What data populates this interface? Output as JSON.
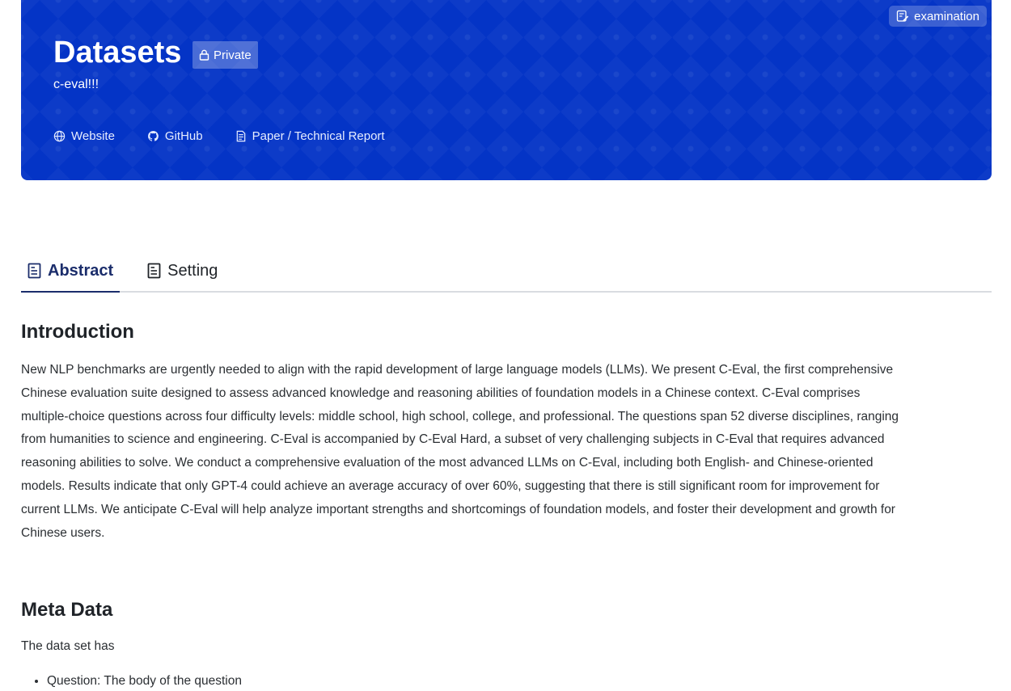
{
  "header": {
    "title": "Datasets",
    "visibility": "Private",
    "subtitle": "c-eval!!!",
    "tag": "examination",
    "links": [
      {
        "label": "Website",
        "icon": "globe-icon"
      },
      {
        "label": "GitHub",
        "icon": "github-icon"
      },
      {
        "label": "Paper / Technical Report",
        "icon": "document-icon"
      }
    ],
    "colors": {
      "banner": "#0434c6",
      "active_tab": "#1b2d6b"
    }
  },
  "tabs": [
    {
      "label": "Abstract",
      "active": true,
      "icon": "document-icon"
    },
    {
      "label": "Setting",
      "active": false,
      "icon": "document-icon"
    }
  ],
  "content": {
    "introduction": {
      "heading": "Introduction",
      "body": "New NLP benchmarks are urgently needed to align with the rapid development of large language models (LLMs). We present C-Eval, the first comprehensive Chinese evaluation suite designed to assess advanced knowledge and reasoning abilities of foundation models in a Chinese context. C-Eval comprises multiple-choice questions across four difficulty levels: middle school, high school, college, and professional. The questions span 52 diverse disciplines, ranging from humanities to science and engineering. C-Eval is accompanied by C-Eval Hard, a subset of very challenging subjects in C-Eval that requires advanced reasoning abilities to solve. We conduct a comprehensive evaluation of the most advanced LLMs on C-Eval, including both English- and Chinese-oriented models. Results indicate that only GPT-4 could achieve an average accuracy of over 60%, suggesting that there is still significant room for improvement for current LLMs. We anticipate C-Eval will help analyze important strengths and shortcomings of foundation models, and foster their development and growth for Chinese users."
    },
    "meta": {
      "heading": "Meta Data",
      "intro": "The data set has",
      "items": [
        "Question: The body of the question"
      ]
    }
  }
}
